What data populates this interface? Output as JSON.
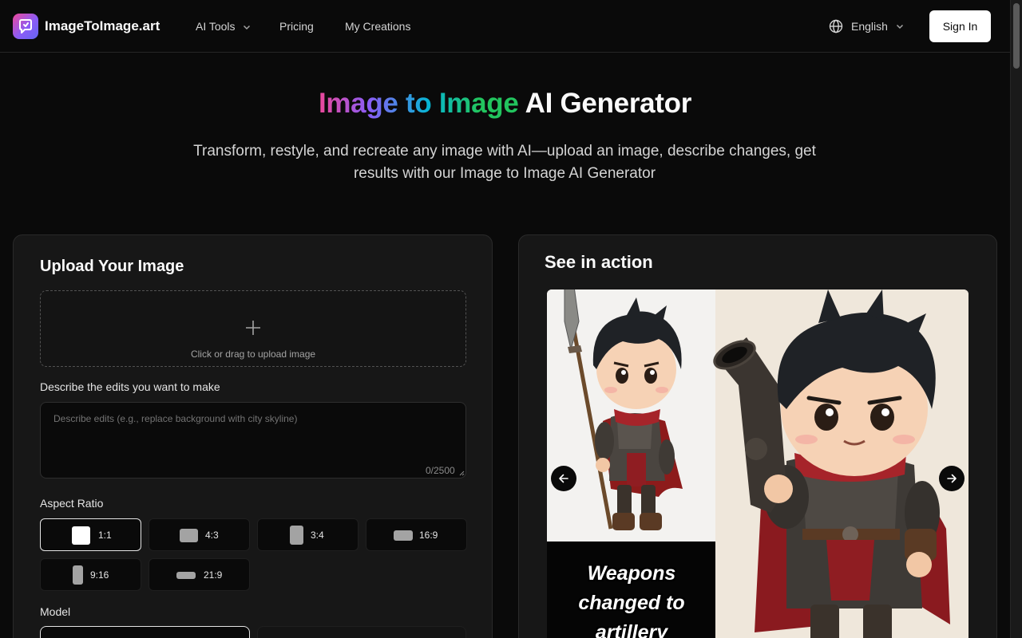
{
  "nav": {
    "brand": "ImageToImage.art",
    "links": [
      {
        "label": "AI Tools",
        "icon": "chevron-down-icon"
      },
      {
        "label": "Pricing"
      },
      {
        "label": "My Creations"
      }
    ],
    "language": "English",
    "sign_in": "Sign In"
  },
  "hero": {
    "title_gradient": "Image to Image",
    "title_rest": " AI Generator",
    "subtitle": "Transform, restyle, and recreate any image with AI—upload an image, describe changes, get results with our Image to Image AI Generator"
  },
  "upload_panel": {
    "title": "Upload Your Image",
    "upload_label": "Click or drag to upload image",
    "edits_label": "Describe the edits you want to make",
    "edits_placeholder": "Describe edits (e.g., replace background with city skyline)",
    "edits_value": "",
    "counter": "0/2500",
    "aspect_label": "Aspect Ratio",
    "aspect_ratios": [
      {
        "label": "1:1",
        "selected": true
      },
      {
        "label": "4:3",
        "selected": false
      },
      {
        "label": "3:4",
        "selected": false
      },
      {
        "label": "16:9",
        "selected": false
      },
      {
        "label": "9:16",
        "selected": false
      },
      {
        "label": "21:9",
        "selected": false
      }
    ],
    "model_label": "Model"
  },
  "showcase": {
    "title": "See in action",
    "caption": "Weapons changed to artillery"
  },
  "colors": {
    "background": "#0a0a0a",
    "panel": "#171717",
    "gradient": [
      "#ec4899",
      "#8b5cf6",
      "#06b6d4",
      "#22c55e"
    ]
  }
}
